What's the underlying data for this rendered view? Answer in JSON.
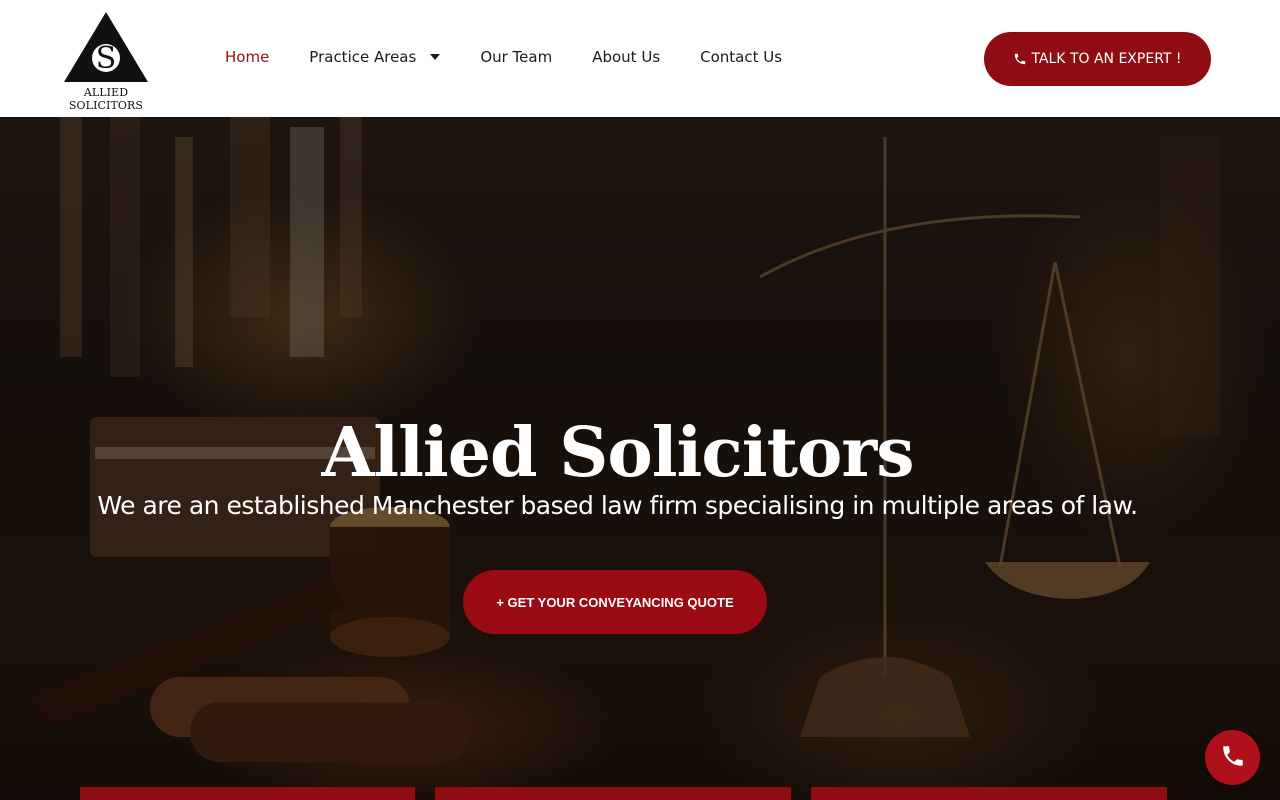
{
  "brand": {
    "logo_letter": "S",
    "logo_text": "ALLIED SOLICITORS"
  },
  "nav": {
    "items": [
      {
        "label": "Home",
        "active": true
      },
      {
        "label": "Practice Areas",
        "has_dropdown": true
      },
      {
        "label": "Our Team"
      },
      {
        "label": "About Us"
      },
      {
        "label": "Contact Us"
      }
    ]
  },
  "header_cta": {
    "label": "TALK TO AN EXPERT !",
    "icon": "phone-icon"
  },
  "hero": {
    "title": "Allied Solicitors",
    "subtitle": "We are an established Manchester based law firm specialising in multiple areas of law.",
    "cta_label": "+ GET YOUR CONVEYANCING QUOTE"
  },
  "floating_call": {
    "icon": "phone-icon"
  },
  "colors": {
    "accent": "#9a0b13",
    "nav_active": "#9d0d14",
    "text_dark": "#1b1b1b"
  }
}
